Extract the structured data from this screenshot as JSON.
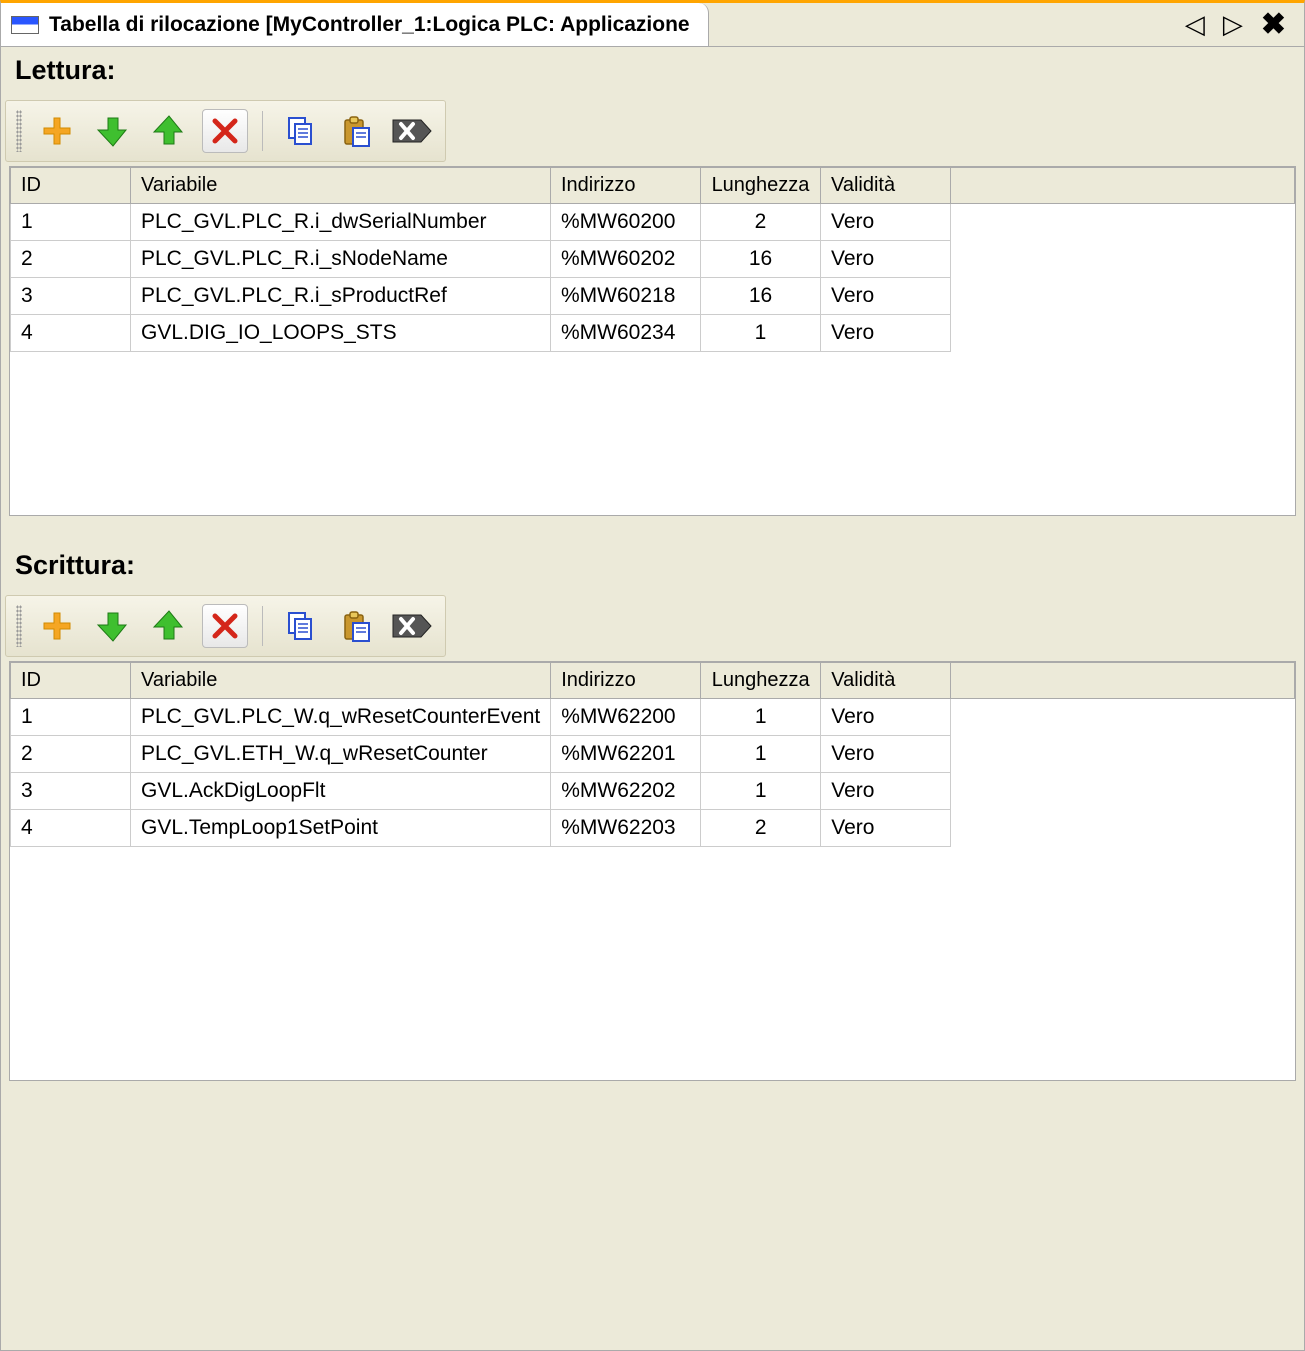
{
  "tab_title": "Tabella di rilocazione [MyController_1:Logica PLC: Applicazione",
  "sections": {
    "read": {
      "title": "Lettura:",
      "columns": {
        "id": "ID",
        "variable": "Variabile",
        "address": "Indirizzo",
        "length": "Lunghezza",
        "validity": "Validità"
      },
      "rows": [
        {
          "id": "1",
          "variable": "PLC_GVL.PLC_R.i_dwSerialNumber",
          "address": "%MW60200",
          "length": "2",
          "validity": "Vero"
        },
        {
          "id": "2",
          "variable": "PLC_GVL.PLC_R.i_sNodeName",
          "address": "%MW60202",
          "length": "16",
          "validity": "Vero"
        },
        {
          "id": "3",
          "variable": "PLC_GVL.PLC_R.i_sProductRef",
          "address": "%MW60218",
          "length": "16",
          "validity": "Vero"
        },
        {
          "id": "4",
          "variable": "GVL.DIG_IO_LOOPS_STS",
          "address": "%MW60234",
          "length": "1",
          "validity": "Vero"
        }
      ]
    },
    "write": {
      "title": "Scrittura:",
      "columns": {
        "id": "ID",
        "variable": "Variabile",
        "address": "Indirizzo",
        "length": "Lunghezza",
        "validity": "Validità"
      },
      "rows": [
        {
          "id": "1",
          "variable": "PLC_GVL.PLC_W.q_wResetCounterEvent",
          "address": "%MW62200",
          "length": "1",
          "validity": "Vero"
        },
        {
          "id": "2",
          "variable": "PLC_GVL.ETH_W.q_wResetCounter",
          "address": "%MW62201",
          "length": "1",
          "validity": "Vero"
        },
        {
          "id": "3",
          "variable": "GVL.AckDigLoopFlt",
          "address": "%MW62202",
          "length": "1",
          "validity": "Vero"
        },
        {
          "id": "4",
          "variable": "GVL.TempLoop1SetPoint",
          "address": "%MW62203",
          "length": "2",
          "validity": "Vero"
        }
      ]
    }
  },
  "icons": {
    "add": "plus-icon",
    "down": "arrow-down-icon",
    "up": "arrow-up-icon",
    "delete": "delete-x-icon",
    "copy": "copy-icon",
    "paste": "paste-icon",
    "clear": "clear-tag-icon"
  }
}
